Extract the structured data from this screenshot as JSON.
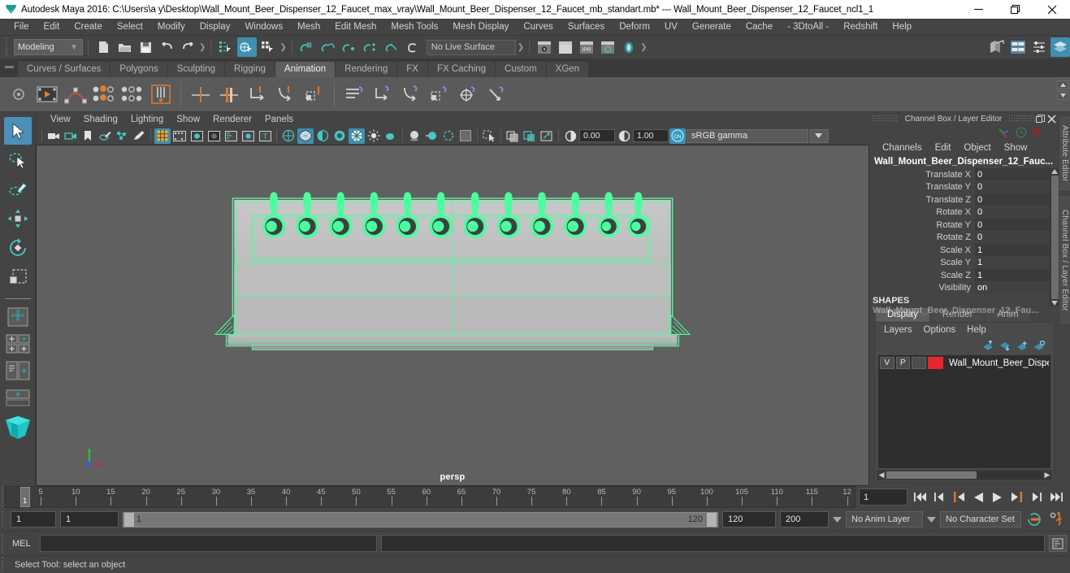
{
  "window": {
    "title": "Autodesk Maya 2016: C:\\Users\\a y\\Desktop\\Wall_Mount_Beer_Dispenser_12_Faucet_max_vray\\Wall_Mount_Beer_Dispenser_12_Faucet_mb_standart.mb*  ---  Wall_Mount_Beer_Dispenser_12_Faucet_ncl1_1",
    "minimize": "─",
    "maximize": "❐",
    "close": "✕"
  },
  "menu": {
    "items": [
      "File",
      "Edit",
      "Create",
      "Select",
      "Modify",
      "Display",
      "Windows",
      "Mesh",
      "Edit Mesh",
      "Mesh Tools",
      "Mesh Display",
      "Curves",
      "Surfaces",
      "Deform",
      "UV",
      "Generate",
      "Cache",
      "- 3DtoAll -",
      "Redshift",
      "Help"
    ]
  },
  "status_bar": {
    "mode": "Modeling",
    "live_surface": "No Live Surface",
    "mode_arrow": "▼"
  },
  "shelf": {
    "tabs": [
      "Curves / Surfaces",
      "Polygons",
      "Sculpting",
      "Rigging",
      "Animation",
      "Rendering",
      "FX",
      "FX Caching",
      "Custom",
      "XGen"
    ],
    "active_tab": "Animation"
  },
  "viewport": {
    "menus": [
      "View",
      "Shading",
      "Lighting",
      "Show",
      "Renderer",
      "Panels"
    ],
    "exposure": "0.00",
    "gamma_value": "1.00",
    "color_management": "sRGB gamma",
    "camera_label": "persp",
    "gamma_toggle": "ON"
  },
  "channel_box": {
    "panel_title": "Channel Box / Layer Editor",
    "menus": [
      "Channels",
      "Edit",
      "Object",
      "Show"
    ],
    "object_name": "Wall_Mount_Beer_Dispenser_12_Fauc...",
    "attributes": [
      {
        "label": "Translate X",
        "value": "0"
      },
      {
        "label": "Translate Y",
        "value": "0"
      },
      {
        "label": "Translate Z",
        "value": "0"
      },
      {
        "label": "Rotate X",
        "value": "0"
      },
      {
        "label": "Rotate Y",
        "value": "0"
      },
      {
        "label": "Rotate Z",
        "value": "0"
      },
      {
        "label": "Scale X",
        "value": "1"
      },
      {
        "label": "Scale Y",
        "value": "1"
      },
      {
        "label": "Scale Z",
        "value": "1"
      },
      {
        "label": "Visibility",
        "value": "on"
      }
    ],
    "shapes_header": "SHAPES",
    "shape_name": "Wall_Mount_Beer_Dispenser_12_Fau..."
  },
  "layer_editor": {
    "tabs": [
      "Display",
      "Render",
      "Anim"
    ],
    "active_tab": "Display",
    "menus": [
      "Layers",
      "Options",
      "Help"
    ],
    "layers": [
      {
        "visibility": "V",
        "playback": "P",
        "shading": "",
        "color": "#e8252e",
        "name": "Wall_Mount_Beer_Dispe"
      }
    ]
  },
  "side_tabs": [
    "Attribute Editor",
    "Channel Box / Layer Editor"
  ],
  "timeline": {
    "ticks": [
      "5",
      "10",
      "15",
      "20",
      "25",
      "30",
      "35",
      "40",
      "45",
      "50",
      "55",
      "60",
      "65",
      "70",
      "75",
      "80",
      "85",
      "90",
      "95",
      "100",
      "105",
      "110",
      "115",
      "12"
    ],
    "current_frame": "1",
    "current_frame_field": "1",
    "playback_buttons": [
      "go-to-start",
      "step-back-key",
      "step-back-frame",
      "play-backwards",
      "play-forwards",
      "step-forward-frame",
      "step-forward-key",
      "go-to-end"
    ]
  },
  "range": {
    "anim_start": "1",
    "range_start": "1",
    "slider_start_label": "1",
    "slider_end_label": "120",
    "range_end": "120",
    "anim_end": "200",
    "anim_layer": "No Anim Layer",
    "character_set": "No Character Set"
  },
  "command_line": {
    "language_label": "MEL",
    "input_value": "",
    "output_value": ""
  },
  "status_line": {
    "help_text": "Select Tool: select an object"
  },
  "colors": {
    "accent_blue": "#3f8fb0",
    "selection_green": "#4dfca0",
    "layer_red": "#e8252e",
    "orange": "#d9782d",
    "viewport_bg": "#606060"
  }
}
